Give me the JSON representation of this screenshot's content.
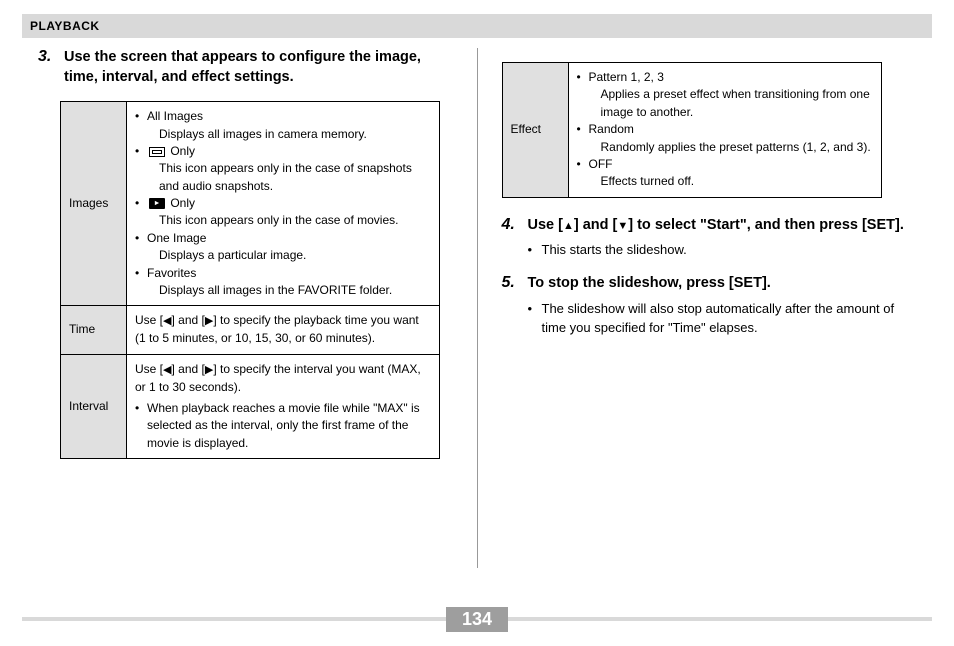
{
  "header": {
    "section": "PLAYBACK"
  },
  "left": {
    "step3": {
      "num": "3.",
      "title": "Use the screen that appears to configure the image, time, interval, and effect settings."
    },
    "table": {
      "images": {
        "label": "Images",
        "b1": "All Images",
        "b1_desc": "Displays all images in camera memory.",
        "b2_suffix": " Only",
        "b2_desc": "This icon appears only in the case of snapshots and audio snapshots.",
        "b3_suffix": " Only",
        "b3_desc": "This icon appears only in the case of movies.",
        "b4": "One Image",
        "b4_desc": "Displays a particular image.",
        "b5": "Favorites",
        "b5_desc": "Displays all images in the FAVORITE folder."
      },
      "time": {
        "label": "Time",
        "text_a": "Use [",
        "text_b": "] and [",
        "text_c": "] to specify the playback time you want (1 to 5 minutes, or 10, 15, 30, or 60 minutes)."
      },
      "interval": {
        "label": "Interval",
        "text_a": "Use [",
        "text_b": "] and [",
        "text_c": "] to specify the interval you want (MAX, or 1 to 30 seconds).",
        "b1": "When playback reaches a movie file while \"MAX\" is selected as the interval, only the first frame of the movie is displayed."
      }
    }
  },
  "right": {
    "effect": {
      "label": "Effect",
      "b1": "Pattern 1, 2, 3",
      "b1_desc": "Applies a preset effect when transitioning from one image to another.",
      "b2": "Random",
      "b2_desc": "Randomly applies the preset patterns (1, 2, and 3).",
      "b3": "OFF",
      "b3_desc": "Effects turned off."
    },
    "step4": {
      "num": "4.",
      "title_a": "Use [",
      "title_b": "] and [",
      "title_c": "] to select \"Start\", and then press [SET].",
      "sub1": "This starts the slideshow."
    },
    "step5": {
      "num": "5.",
      "title": "To stop the slideshow, press [SET].",
      "sub1": "The slideshow will also stop automatically after the amount of time you specified for \"Time\" elapses."
    }
  },
  "footer": {
    "page": "134"
  },
  "glyphs": {
    "left": "◀",
    "right": "▶",
    "up": "▲",
    "down": "▼"
  }
}
